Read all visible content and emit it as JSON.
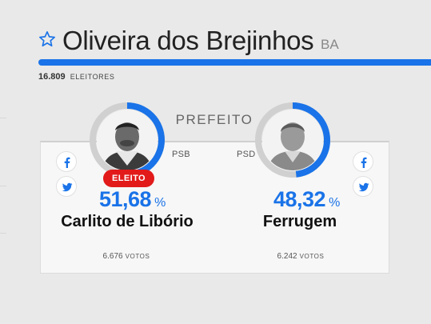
{
  "header": {
    "city": "Oliveira dos Brejinhos",
    "state": "BA",
    "voters_count": "16.809",
    "voters_label": "ELEITORES",
    "progress_fraction": 1.0
  },
  "race": {
    "office": "PREFEITO"
  },
  "candidates": [
    {
      "name": "Carlito de Libório",
      "party": "PSB",
      "percent": "51,68",
      "percent_symbol": "%",
      "votes": "6.676",
      "votes_label": "VOTOS",
      "badge": "ELEITO",
      "ring_fraction": 0.5168
    },
    {
      "name": "Ferrugem",
      "party": "PSD",
      "percent": "48,32",
      "percent_symbol": "%",
      "votes": "6.242",
      "votes_label": "VOTOS",
      "ring_fraction": 0.4832
    }
  ],
  "colors": {
    "accent": "#1a73e8",
    "elected": "#e21a1a",
    "ring_track": "#d0d0d0"
  },
  "icons": [
    "star-icon",
    "facebook-icon",
    "twitter-icon"
  ]
}
